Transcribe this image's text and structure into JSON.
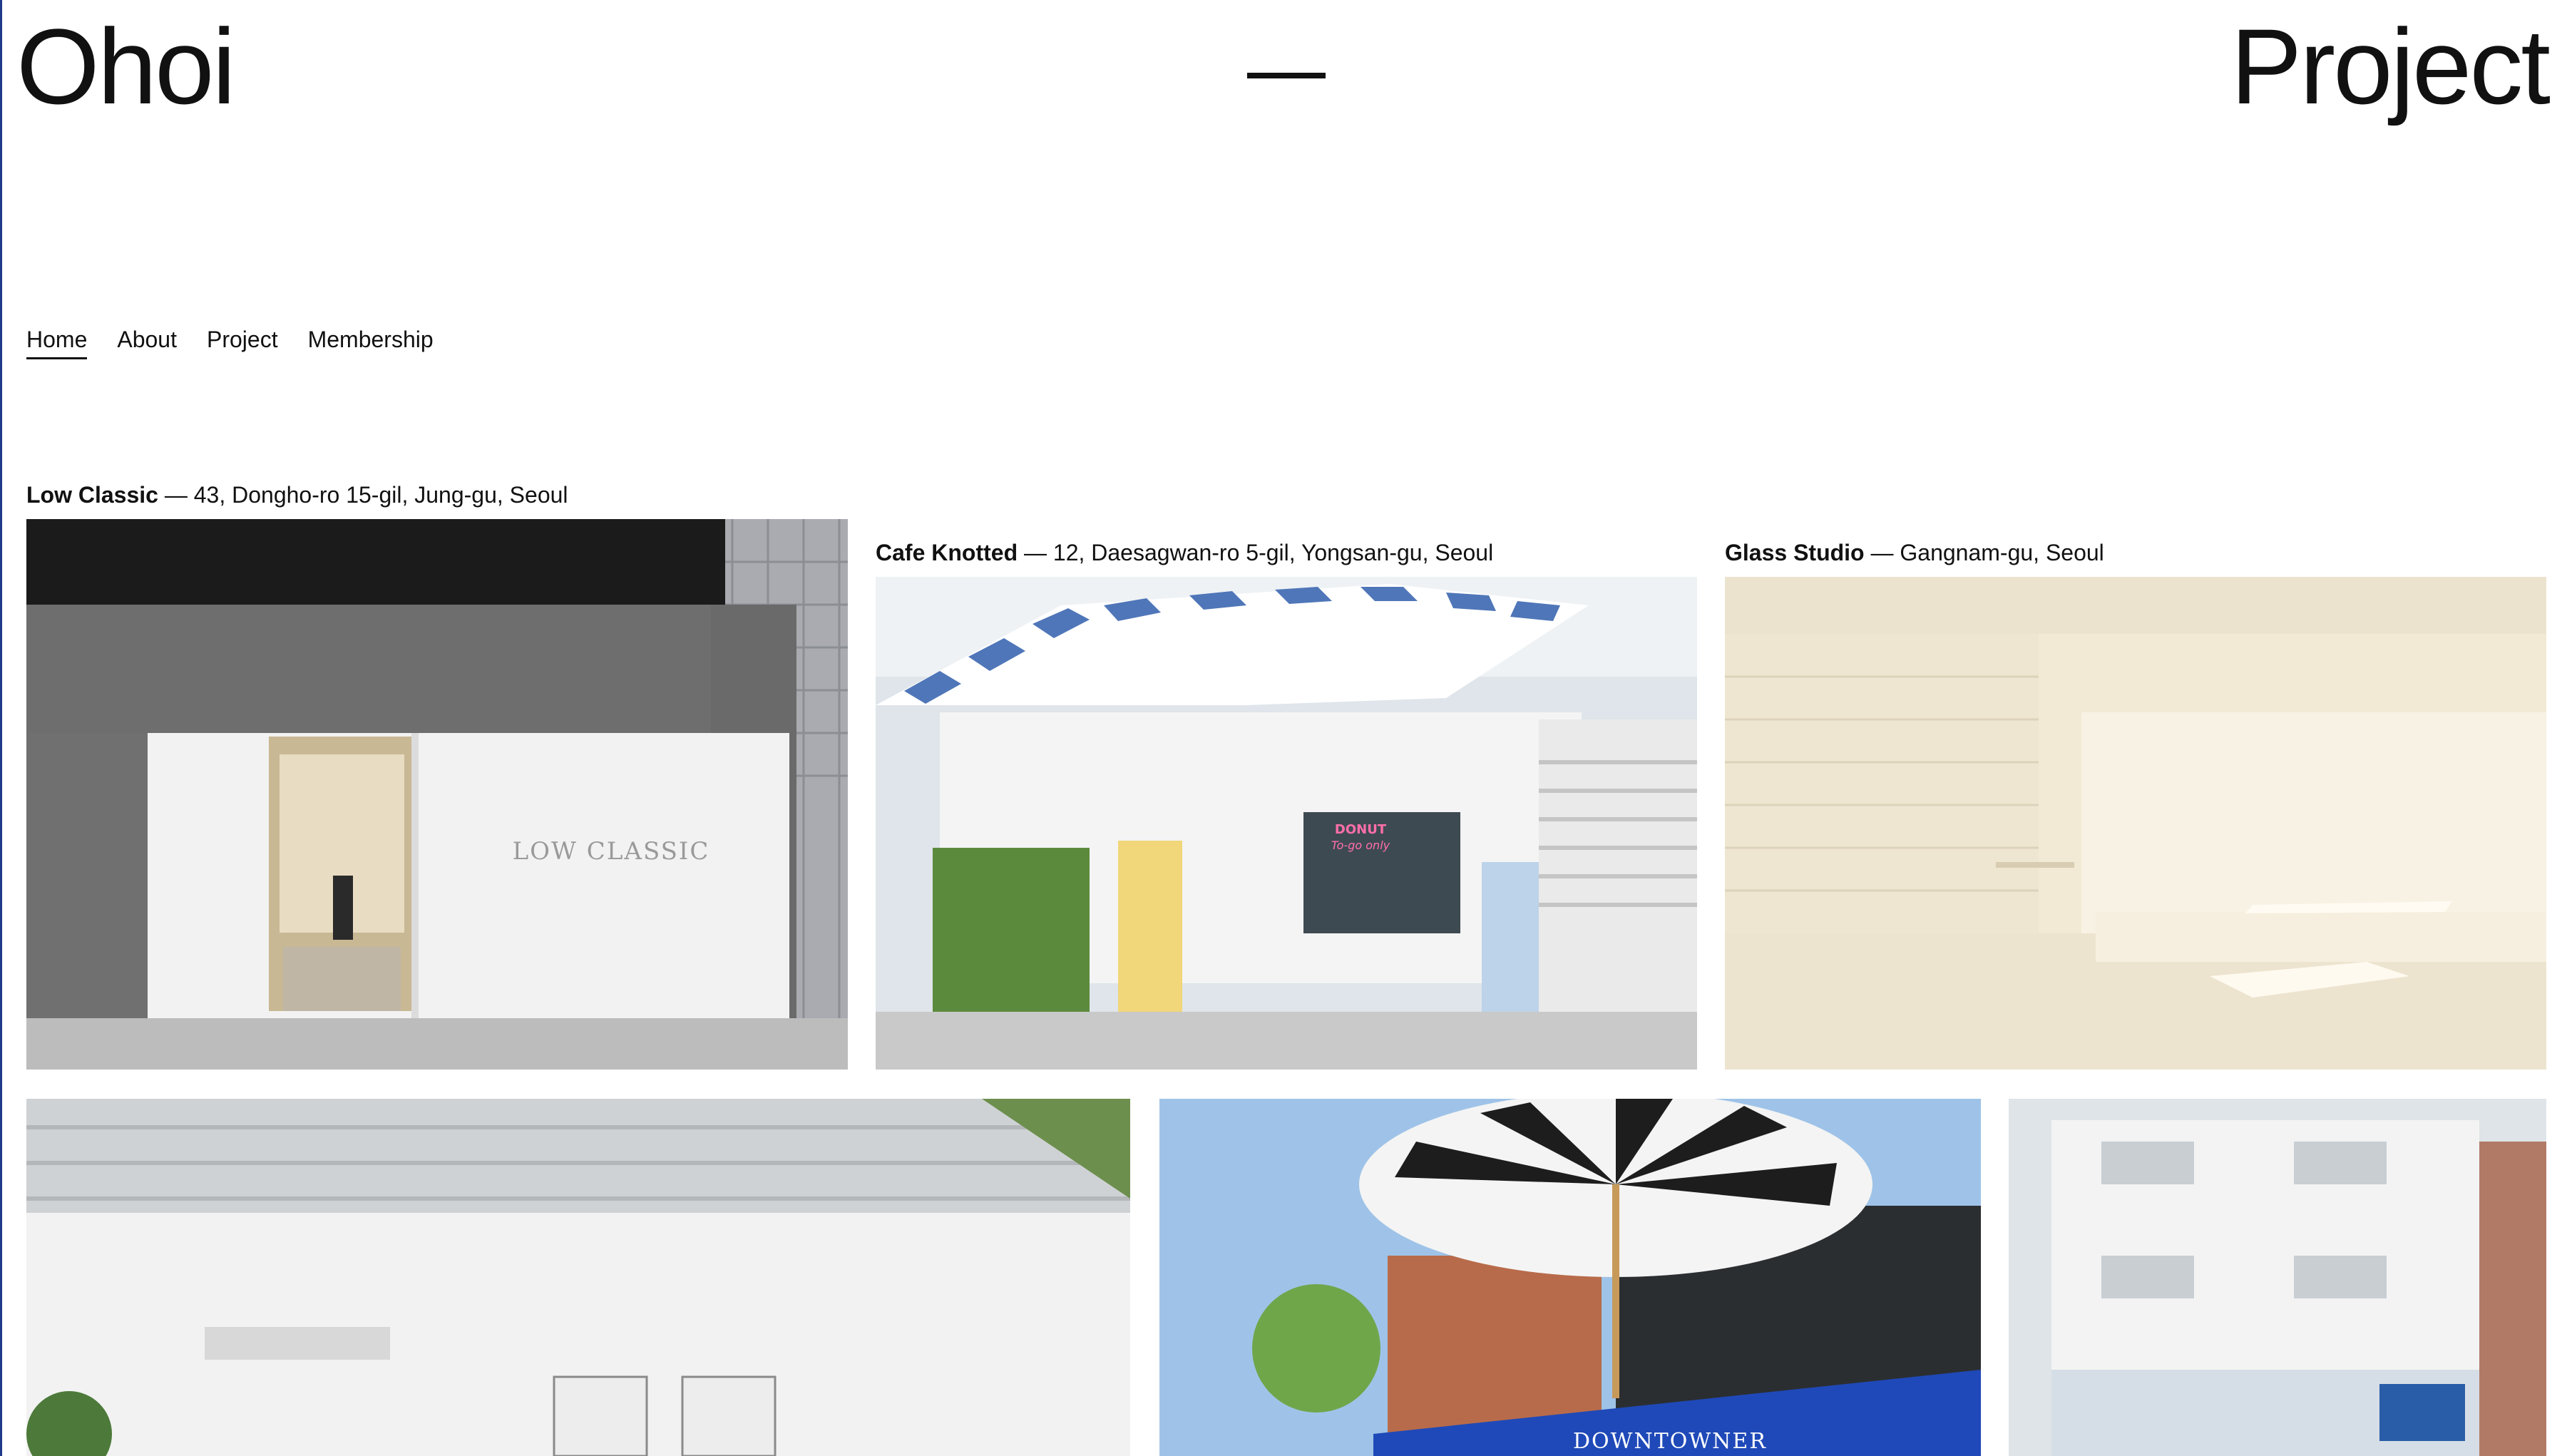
{
  "header": {
    "brand": "Ohoi",
    "separator": "—",
    "section": "Project"
  },
  "nav": {
    "items": [
      {
        "label": "Home",
        "active": true
      },
      {
        "label": "About",
        "active": false
      },
      {
        "label": "Project",
        "active": false
      },
      {
        "label": "Membership",
        "active": false
      }
    ]
  },
  "projects": [
    {
      "name": "Low Classic",
      "address": " — 43, Dongho-ro 15-gil, Jung-gu, Seoul",
      "sign": "LOW CLASSIC"
    },
    {
      "name": "Cafe Knotted",
      "address": " — 12, Daesagwan-ro 5-gil, Yongsan-gu, Seoul",
      "sign": "DONUT",
      "sign2": "To-go only"
    },
    {
      "name": "Glass Studio",
      "address": " — Gangnam-gu, Seoul"
    },
    {
      "name": "",
      "address": ""
    },
    {
      "name": "",
      "address": "",
      "sign": "DOWNTOWNER"
    },
    {
      "name": "",
      "address": ""
    }
  ],
  "colors": {
    "accent_border": "#1f3a8a",
    "text": "#111111",
    "background": "#ffffff"
  }
}
